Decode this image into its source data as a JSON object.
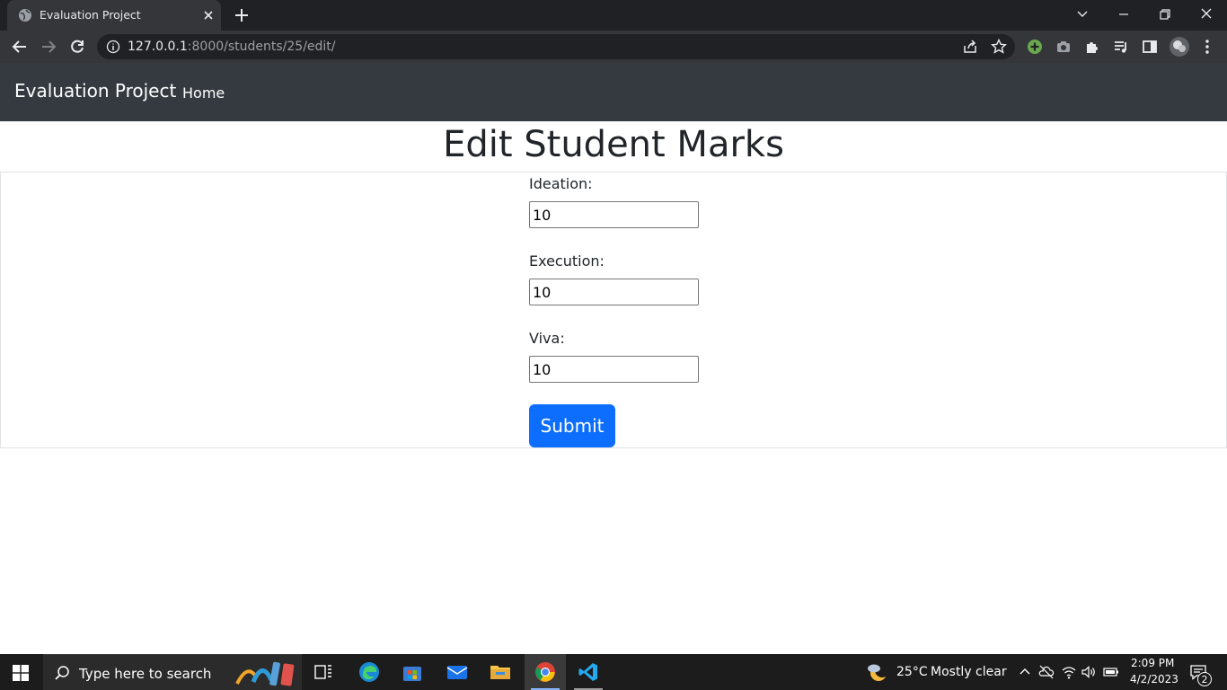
{
  "browser": {
    "tab_title": "Evaluation Project",
    "url_host": "127.0.0.1",
    "url_rest": ":8000/students/25/edit/"
  },
  "navbar": {
    "brand": "Evaluation Project",
    "home_link": "Home"
  },
  "page": {
    "title": "Edit Student Marks",
    "fields": [
      {
        "label": "Ideation:",
        "value": "10"
      },
      {
        "label": "Execution:",
        "value": "10"
      },
      {
        "label": "Viva:",
        "value": "10"
      }
    ],
    "submit_label": "Submit",
    "accent_color": "#0d6efd"
  },
  "taskbar": {
    "search_placeholder": "Type here to search",
    "weather_temp": "25°C",
    "weather_desc": "Mostly clear",
    "time": "2:09 PM",
    "date": "4/2/2023",
    "notification_count": "2"
  }
}
